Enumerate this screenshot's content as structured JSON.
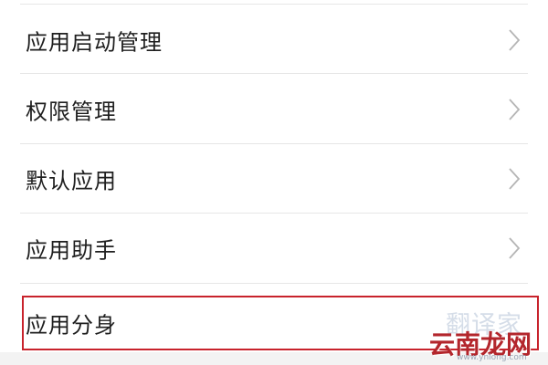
{
  "settings": {
    "items": [
      {
        "label": "应用启动管理",
        "has_chevron": true
      },
      {
        "label": "权限管理",
        "has_chevron": true
      },
      {
        "label": "默认应用",
        "has_chevron": true
      },
      {
        "label": "应用助手",
        "has_chevron": true
      },
      {
        "label": "应用分身",
        "has_chevron": false,
        "highlighted": true
      }
    ],
    "chevron_icon": "chevron-right-icon",
    "highlight_color": "#c8232c"
  },
  "watermark": {
    "top_text": "翻译家",
    "main_text": "云南龙网",
    "sub_text": "www.ynlong.com"
  }
}
